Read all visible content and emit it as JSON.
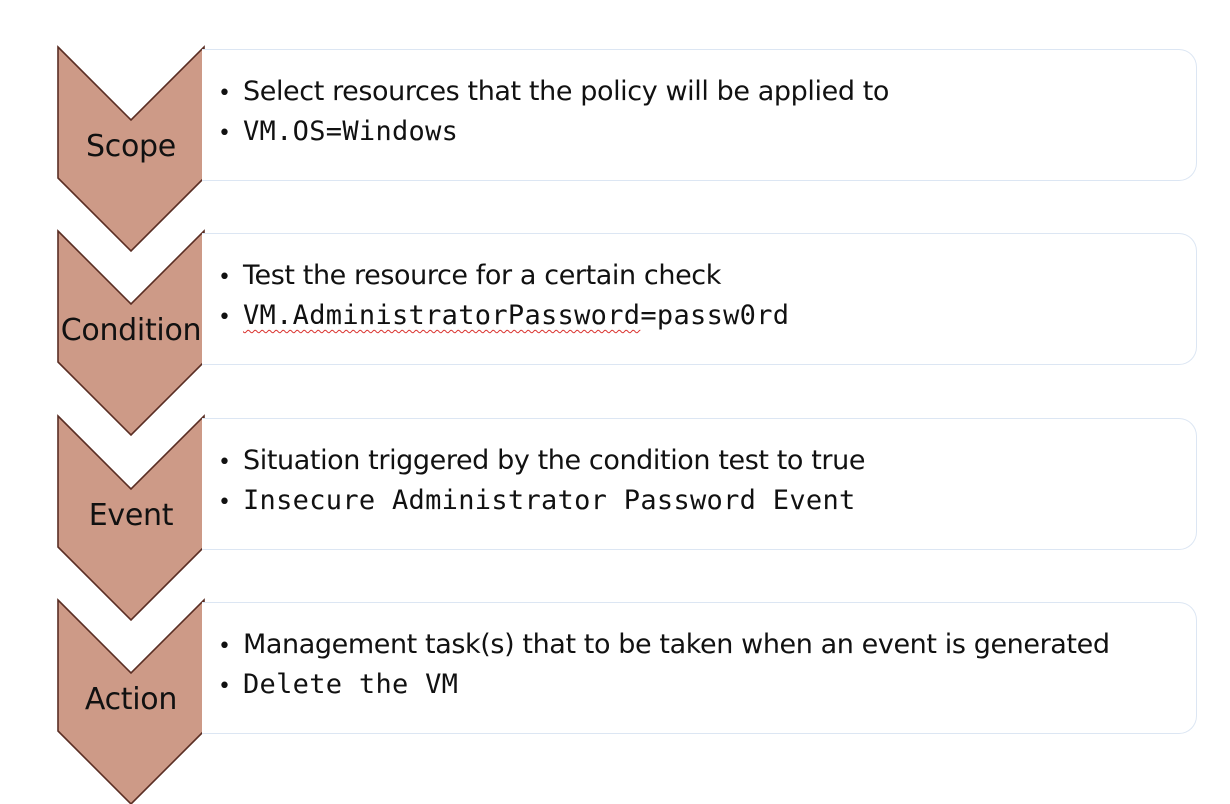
{
  "colors": {
    "chevron_fill": "#cd9a87",
    "chevron_stroke": "#5a2e24",
    "panel_border": "#dce6f3",
    "spellcheck_underline": "#d9302c"
  },
  "stages": [
    {
      "label": "Scope",
      "description": "Select resources that the policy will be applied to",
      "example": "VM.OS=Windows"
    },
    {
      "label": "Condition",
      "description": "Test the resource for a certain check",
      "example_marked": "VM.AdministratorPassword",
      "example_rest": "=passw0rd"
    },
    {
      "label": "Event",
      "description": "Situation triggered by the condition test to true",
      "example": "Insecure Administrator Password Event"
    },
    {
      "label": "Action",
      "description": "Management task(s) that to be taken when an event is generated",
      "example": "Delete the VM"
    }
  ]
}
